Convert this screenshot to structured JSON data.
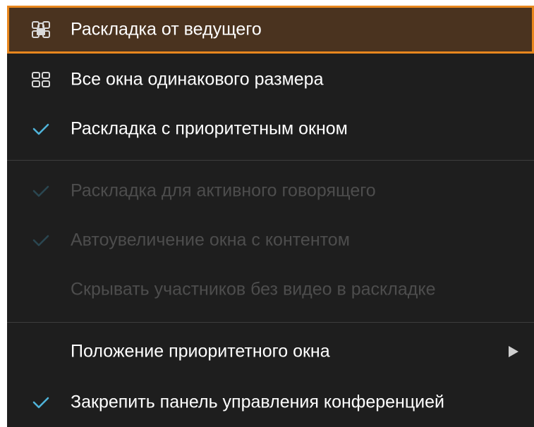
{
  "menu": {
    "items": [
      {
        "label": "Раскладка от ведущего",
        "icon": "presenter-layout-icon",
        "state": "highlighted"
      },
      {
        "label": "Все окна одинакового размера",
        "icon": "grid-layout-icon",
        "state": "enabled"
      },
      {
        "label": "Раскладка с приоритетным окном",
        "icon": "checkmark-icon",
        "state": "checked"
      },
      {
        "label": "Раскладка для активного говорящего",
        "icon": "checkmark-icon",
        "state": "disabled-checked"
      },
      {
        "label": "Автоувеличение окна с контентом",
        "icon": "checkmark-icon",
        "state": "disabled-checked"
      },
      {
        "label": "Скрывать участников без видео в раскладке",
        "icon": "",
        "state": "disabled"
      },
      {
        "label": "Положение приоритетного окна",
        "icon": "submenu-arrow-icon",
        "state": "enabled"
      },
      {
        "label": "Закрепить панель управления конференцией",
        "icon": "checkmark-icon",
        "state": "checked"
      }
    ]
  },
  "colors": {
    "background": "#1e1e1e",
    "highlight_background": "#4a331f",
    "highlight_border": "#e8871e",
    "check_active": "#4fb3d9",
    "check_disabled": "#2a4650",
    "text": "#ffffff",
    "text_disabled": "#4d4d4d"
  }
}
